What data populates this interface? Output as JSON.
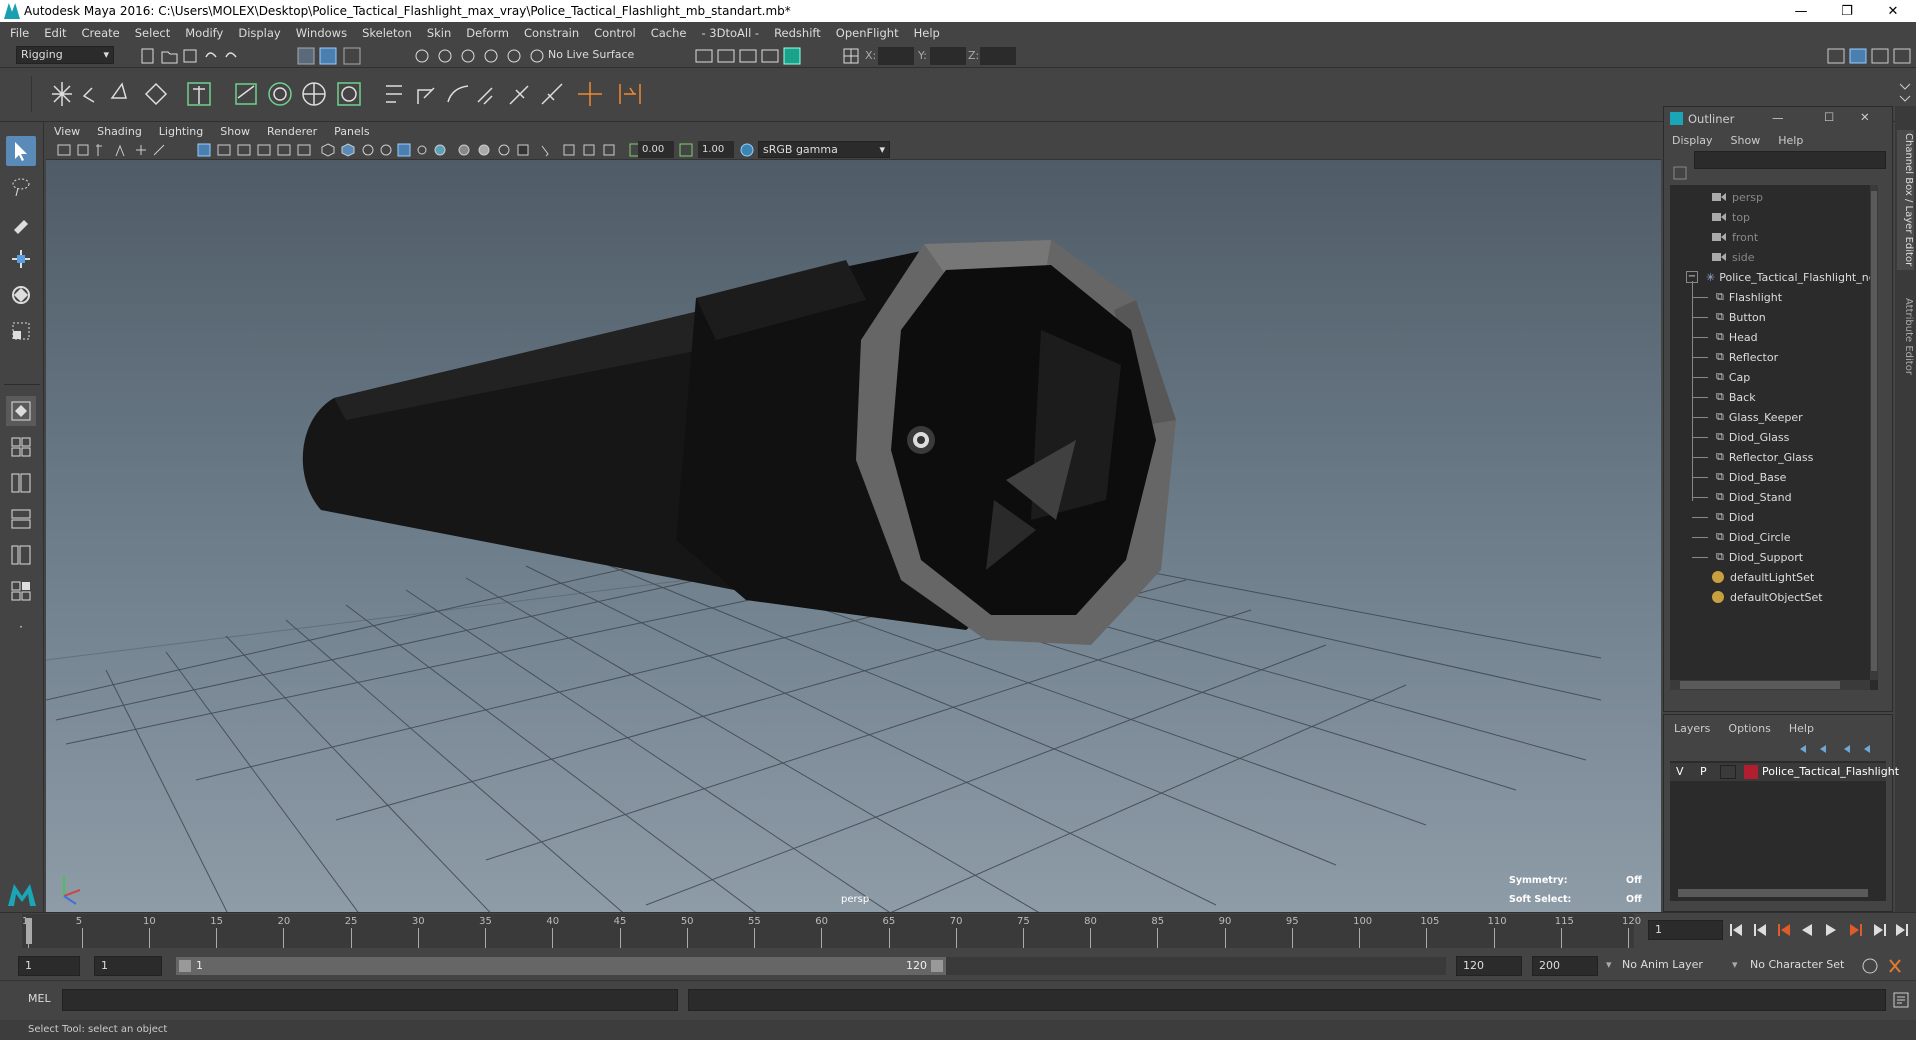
{
  "window": {
    "title": "Autodesk Maya 2016: C:\\Users\\MOLEX\\Desktop\\Police_Tactical_Flashlight_max_vray\\Police_Tactical_Flashlight_mb_standart.mb*",
    "minimize": "—",
    "maximize": "❐",
    "close": "✕"
  },
  "menubar": [
    "File",
    "Edit",
    "Create",
    "Select",
    "Modify",
    "Display",
    "Windows",
    "Skeleton",
    "Skin",
    "Deform",
    "Constrain",
    "Control",
    "Cache",
    "- 3DtoAll -",
    "Redshift",
    "OpenFlight",
    "Help"
  ],
  "statusline": {
    "menu_set": "Rigging",
    "live_surface": "No Live Surface",
    "x_label": "X:",
    "y_label": "Y:",
    "z_label": "Z:"
  },
  "viewport": {
    "menu": [
      "View",
      "Shading",
      "Lighting",
      "Show",
      "Renderer",
      "Panels"
    ],
    "exposure": "0.00",
    "gamma": "1.00",
    "color_space": "sRGB gamma",
    "camera_label": "persp",
    "symmetry_label": "Symmetry:",
    "symmetry_value": "Off",
    "soft_select_label": "Soft Select:",
    "soft_select_value": "Off"
  },
  "outliner": {
    "title": "Outliner",
    "menu": [
      "Display",
      "Show",
      "Help"
    ],
    "cameras": [
      "persp",
      "top",
      "front",
      "side"
    ],
    "group": "Police_Tactical_Flashlight_ncl",
    "children": [
      "Flashlight",
      "Button",
      "Head",
      "Reflector",
      "Cap",
      "Back",
      "Glass_Keeper",
      "Diod_Glass",
      "Reflector_Glass",
      "Diod_Base",
      "Diod_Stand",
      "Diod",
      "Diod_Circle",
      "Diod_Support"
    ],
    "sets": [
      "defaultLightSet",
      "defaultObjectSet"
    ]
  },
  "side_tabs": {
    "channel_box": "Channel Box / Layer Editor",
    "attribute_editor": "Attribute Editor"
  },
  "layers": {
    "menu": [
      "Layers",
      "Options",
      "Help"
    ],
    "row": {
      "v": "V",
      "p": "P",
      "name": "Police_Tactical_Flashlight",
      "color": "#b01e2f"
    }
  },
  "timeline": {
    "ticks": [
      "1",
      "5",
      "10",
      "15",
      "20",
      "25",
      "30",
      "35",
      "40",
      "45",
      "50",
      "55",
      "60",
      "65",
      "70",
      "75",
      "80",
      "85",
      "90",
      "95",
      "100",
      "105",
      "110",
      "115",
      "120"
    ],
    "current_frame": "1"
  },
  "range": {
    "start": "1",
    "playback_start": "1",
    "slider_start": "1",
    "slider_end": "120",
    "playback_end": "120",
    "end": "200",
    "anim_layer": "No Anim Layer",
    "character_set": "No Character Set"
  },
  "cmdline": {
    "label": "MEL"
  },
  "helpline": {
    "text": "Select Tool: select an object"
  }
}
